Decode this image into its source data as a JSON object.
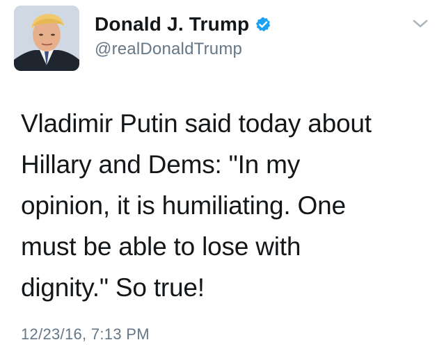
{
  "tweet": {
    "author": {
      "display_name": "Donald J. Trump",
      "username": "@realDonaldTrump",
      "verified": true,
      "avatar_icon": "profile-photo-avatar",
      "verified_icon": "verified-badge-icon"
    },
    "menu_icon": "chevron-down-icon",
    "text": "Vladimir Putin said today about\nHillary and Dems: \"In my\nopinion, it is humiliating. One\nmust be able to lose with\ndignity.\"  So true!",
    "timestamp": "12/23/16, 7:13 PM"
  },
  "colors": {
    "text_primary": "#14171a",
    "text_secondary": "#657786",
    "verified_blue": "#1da1f2",
    "chevron_gray": "#aab8c2",
    "background": "#ffffff"
  }
}
